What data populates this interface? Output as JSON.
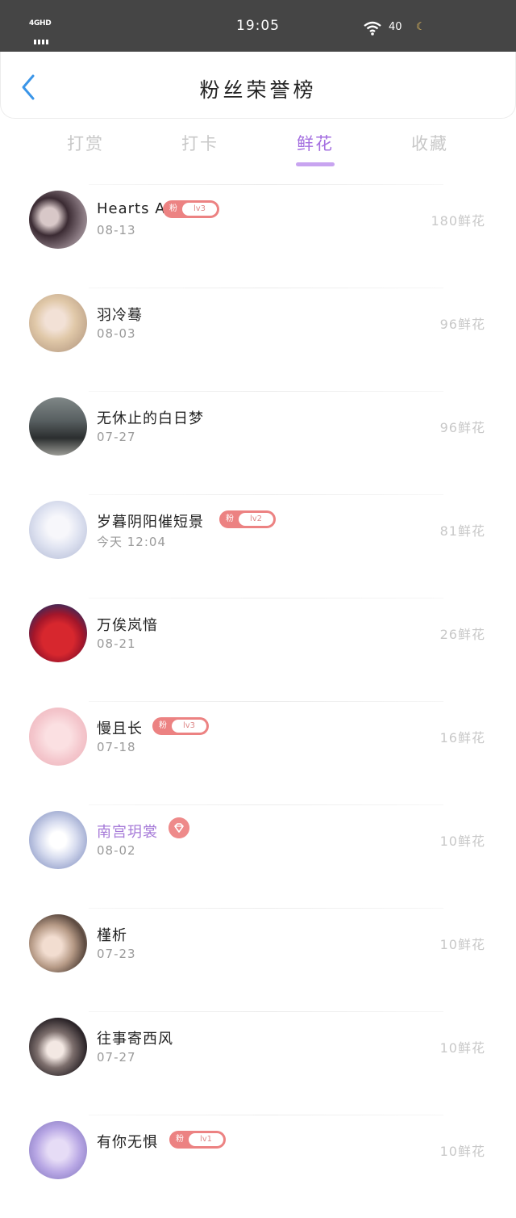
{
  "status": {
    "network": "4GHD",
    "time": "19:05",
    "battery": "40"
  },
  "header": {
    "title": "粉丝荣誉榜"
  },
  "tabs": [
    {
      "label": "打赏"
    },
    {
      "label": "打卡"
    },
    {
      "label": "鲜花"
    },
    {
      "label": "收藏"
    }
  ],
  "active_tab": "鲜花",
  "colors": {
    "accent": "#a46fe0",
    "badge": "#ec8282",
    "vip_name": "#a67ad8",
    "count_text": "#c8c8c8"
  },
  "badge_prefix": "粉",
  "fans": [
    {
      "name": "Hearts A",
      "date": "08-13",
      "count": "180鲜花",
      "level": "lv3"
    },
    {
      "name": "羽冷蓦",
      "date": "08-03",
      "count": "96鲜花",
      "level": ""
    },
    {
      "name": "无休止的白日梦",
      "date": "07-27",
      "count": "96鲜花",
      "level": ""
    },
    {
      "name": "岁暮阴阳催短景",
      "date": "今天 12:04",
      "count": "81鲜花",
      "level": "lv2"
    },
    {
      "name": "万俟岚愔",
      "date": "08-21",
      "count": "26鲜花",
      "level": ""
    },
    {
      "name": "慢且长",
      "date": "07-18",
      "count": "16鲜花",
      "level": "lv3"
    },
    {
      "name": "南宫玥裳",
      "date": "08-02",
      "count": "10鲜花",
      "level": "",
      "vip": true
    },
    {
      "name": "槿析",
      "date": "07-23",
      "count": "10鲜花",
      "level": ""
    },
    {
      "name": "往事寄西风",
      "date": "07-27",
      "count": "10鲜花",
      "level": ""
    },
    {
      "name": "有你无惧",
      "date": "",
      "count": "10鲜花",
      "level": "lv1"
    }
  ]
}
